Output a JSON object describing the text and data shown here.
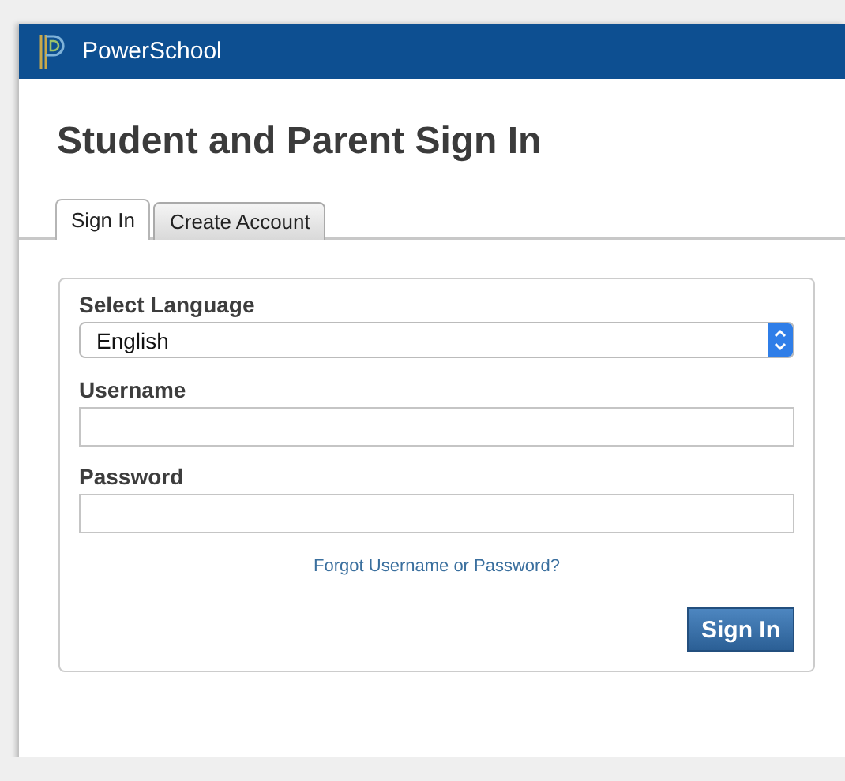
{
  "header": {
    "brand": "PowerSchool"
  },
  "title": "Student and Parent Sign In",
  "tabs": [
    {
      "label": "Sign In",
      "selected": true
    },
    {
      "label": "Create Account",
      "selected": false
    }
  ],
  "form": {
    "fields": [
      {
        "kind": "select",
        "label": "Select Language",
        "value": "English"
      },
      {
        "kind": "text",
        "label": "Username"
      },
      {
        "kind": "password",
        "label": "Password"
      }
    ],
    "link": "Forgot Username or Password?",
    "button": "Sign In"
  }
}
